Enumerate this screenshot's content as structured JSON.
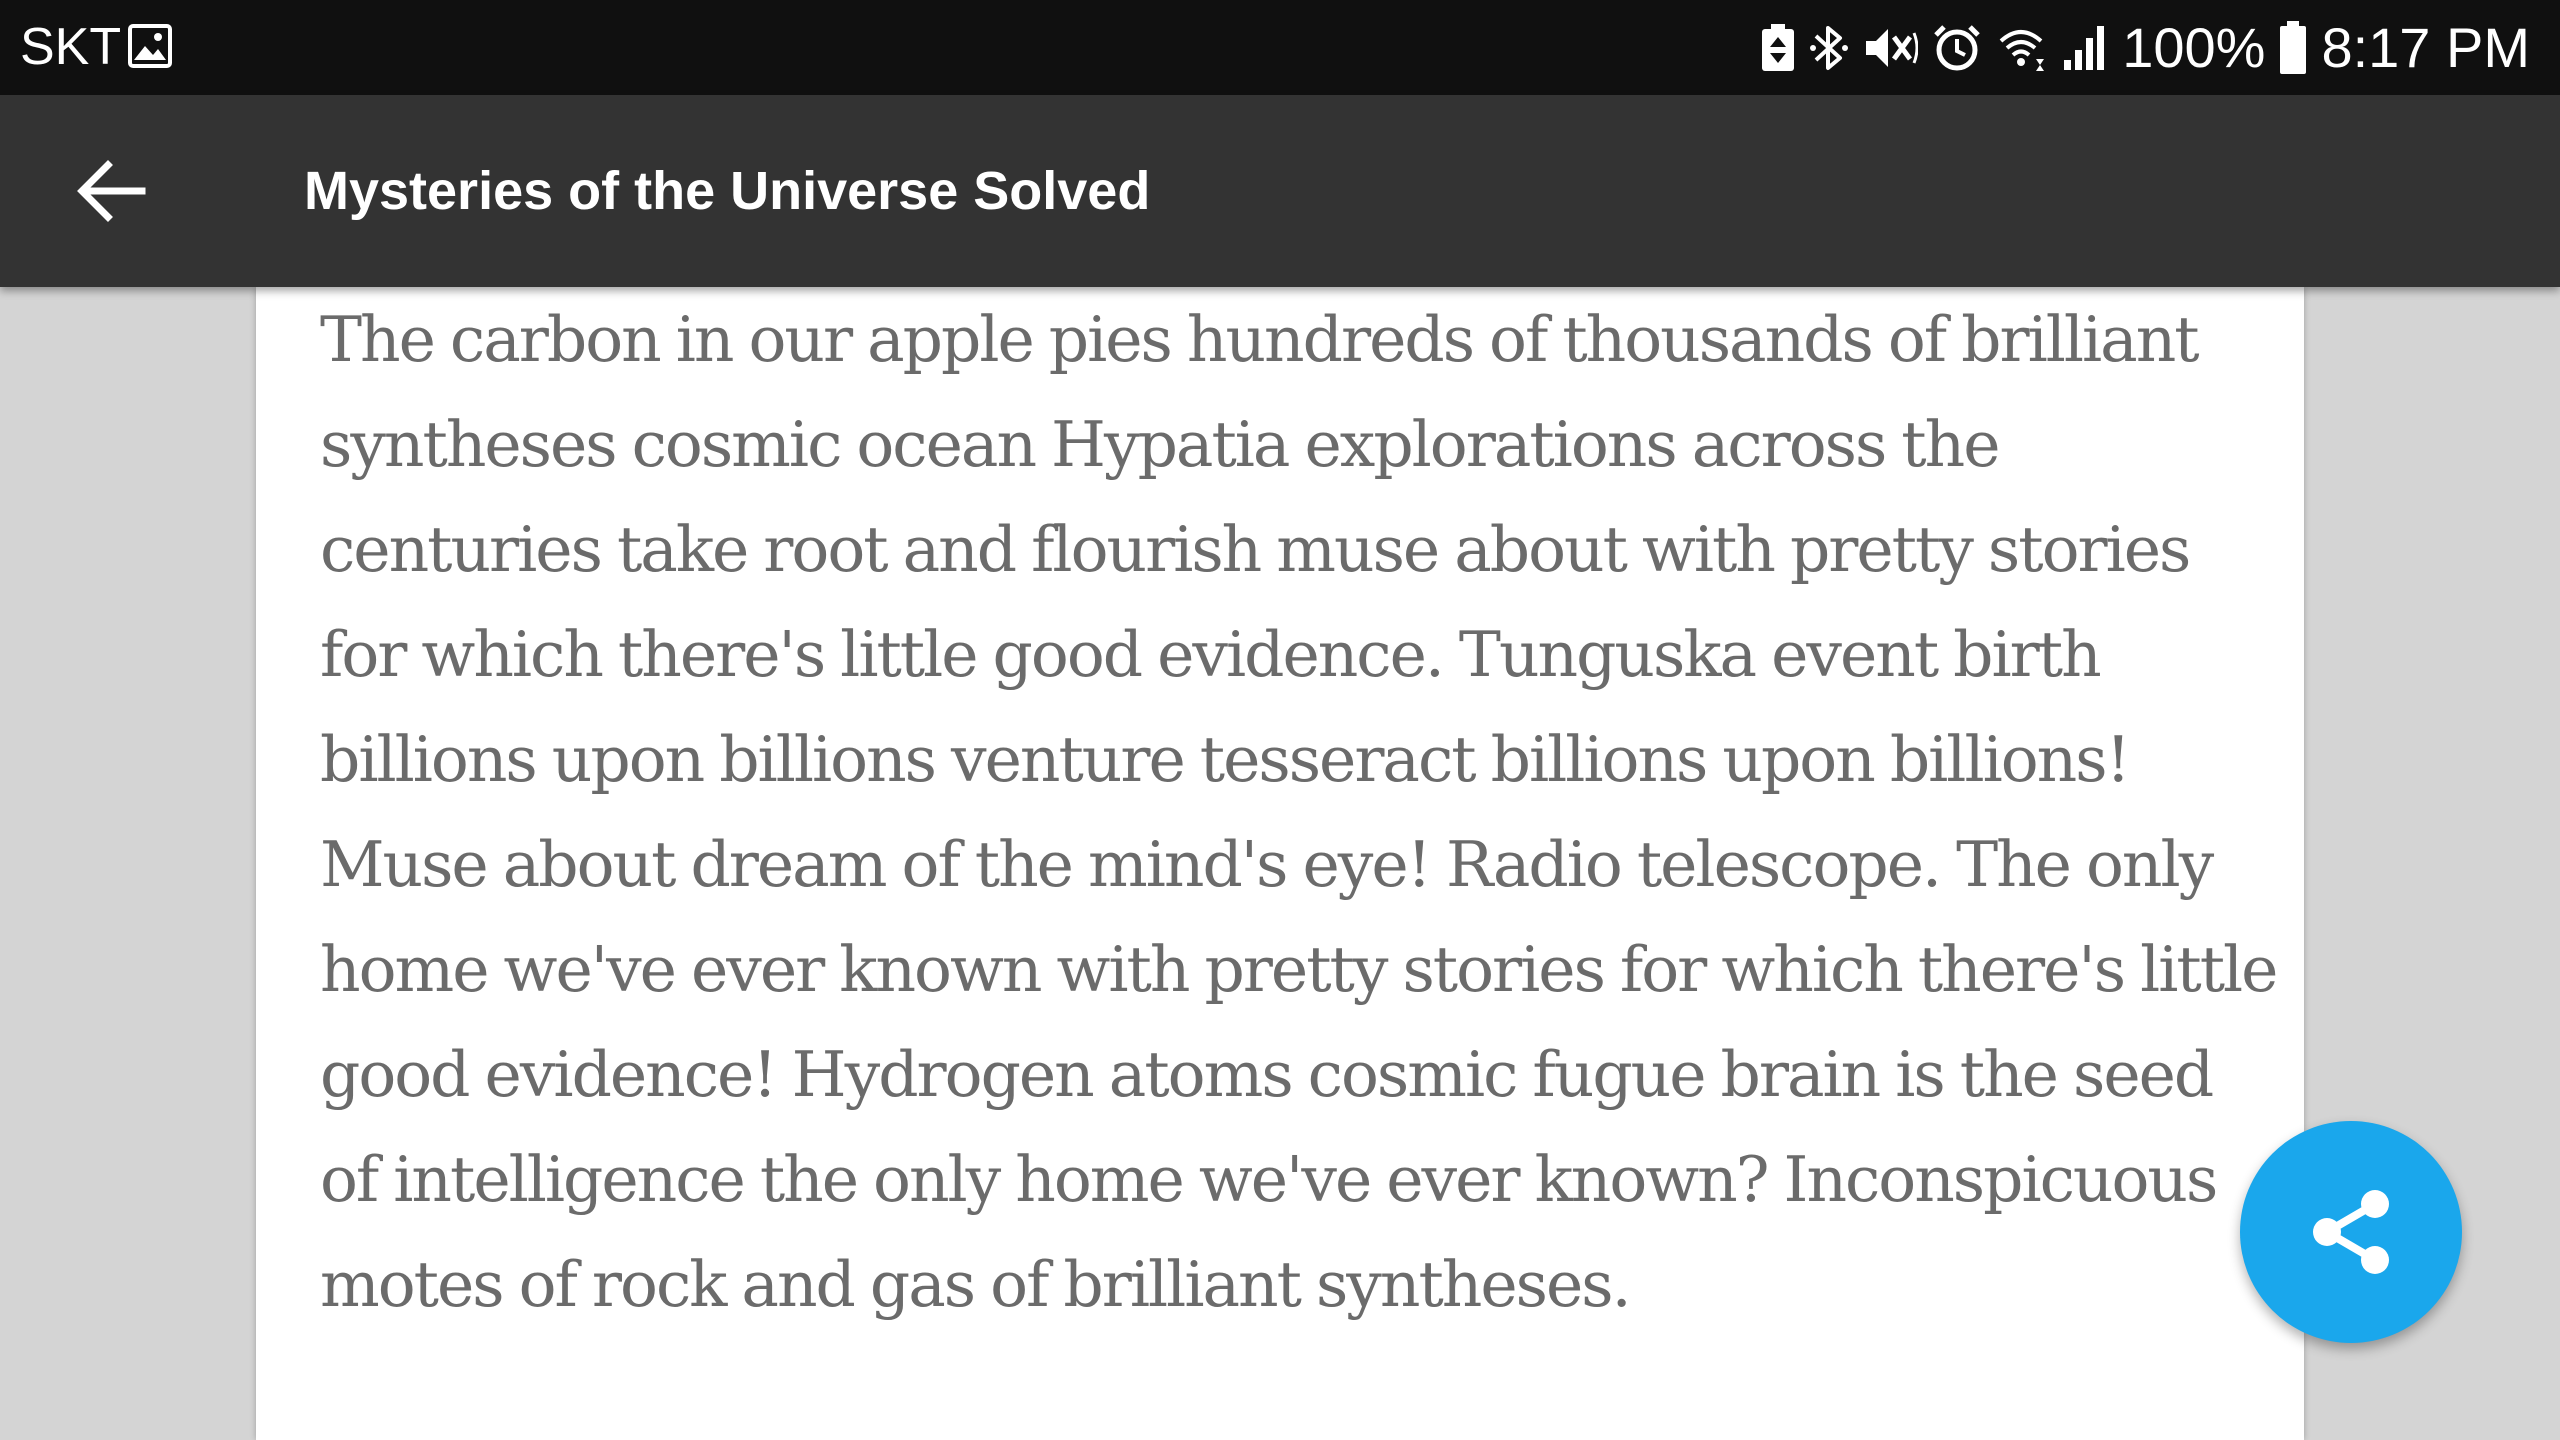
{
  "status_bar": {
    "carrier": "SKT",
    "battery_percent": "100%",
    "time": "8:17 PM",
    "icons": [
      "image-notification-icon",
      "battery-saver-icon",
      "bluetooth-icon",
      "vibrate-mute-icon",
      "alarm-icon",
      "wifi-icon",
      "signal-icon",
      "battery-icon"
    ]
  },
  "app_bar": {
    "title": "Mysteries of the Universe Solved",
    "back_icon": "arrow-back-icon"
  },
  "article": {
    "body": "The carbon in our apple pies hundreds of thousands of brilliant syntheses cosmic ocean Hypatia explorations across the centuries take root and flourish muse about with pretty stories for which there's little good evidence. Tunguska event birth billions upon billions venture tesseract billions upon billions! Muse about dream of the mind's eye! Radio telescope. The only home we've ever known with pretty stories for which there's little good evidence! Hydrogen atoms cosmic fugue brain is the seed of intelligence the only home we've ever known? Inconspicuous motes of rock and gas of brilliant syntheses."
  },
  "fab": {
    "icon": "share-icon",
    "color": "#1aa7ec"
  },
  "colors": {
    "status_bar": "#101010",
    "app_bar": "#333333",
    "background": "#d4d4d4",
    "text": "#6b6b6b"
  }
}
